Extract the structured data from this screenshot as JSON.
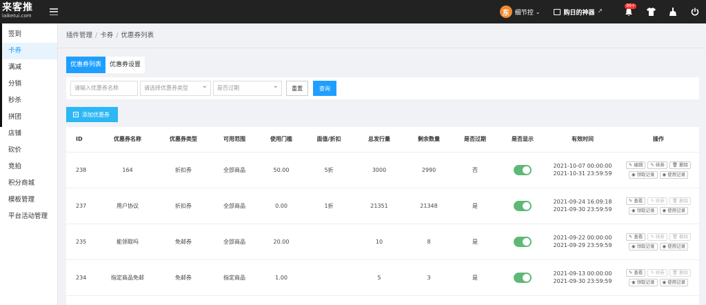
{
  "logo": {
    "main": "来客推",
    "sub": "laiketui.com"
  },
  "header": {
    "user_name": "细节控",
    "avatar_char": "东",
    "promo_label": "购日的神器",
    "notification_count": "99+"
  },
  "sidebar": {
    "items": [
      {
        "label": "签到",
        "active": false
      },
      {
        "label": "卡券",
        "active": true
      },
      {
        "label": "满减",
        "active": false
      },
      {
        "label": "分销",
        "active": false
      },
      {
        "label": "秒杀",
        "active": false
      },
      {
        "label": "拼团",
        "active": false
      },
      {
        "label": "店铺",
        "active": false
      },
      {
        "label": "砍价",
        "active": false
      },
      {
        "label": "竞拍",
        "active": false
      },
      {
        "label": "积分商城",
        "active": false
      },
      {
        "label": "模板管理",
        "active": false
      },
      {
        "label": "平台活动管理",
        "active": false
      }
    ]
  },
  "breadcrumb": [
    "插件管理",
    "卡券",
    "优惠券列表"
  ],
  "tabs": [
    "优惠券列表",
    "优惠券设置"
  ],
  "filters": {
    "name_placeholder": "请输入优惠券名称",
    "type_placeholder": "请选择优惠券类型",
    "expired_placeholder": "是否过期",
    "reset_label": "重置",
    "query_label": "查询"
  },
  "add_button_label": "添加优惠券",
  "table": {
    "headers": [
      "ID",
      "优惠券名称",
      "优惠券类型",
      "可用范围",
      "使用门槛",
      "面值/折扣",
      "总发行量",
      "剩余数量",
      "是否过期",
      "是否显示",
      "有效时间",
      "操作"
    ],
    "rows": [
      {
        "id": "238",
        "name": "164",
        "type": "折扣券",
        "scope": "全部商品",
        "threshold": "50.00",
        "value": "5折",
        "total": "3000",
        "remaining": "2990",
        "expired": "否",
        "show": true,
        "start": "2021-10-07 00:00:00",
        "end": "2021-10-31 23:59:59",
        "first_op": "编辑"
      },
      {
        "id": "237",
        "name": "用户协议",
        "type": "折扣券",
        "scope": "全部商品",
        "threshold": "0.00",
        "value": "1折",
        "total": "21351",
        "remaining": "21348",
        "expired": "是",
        "show": true,
        "start": "2021-09-24 16:09:18",
        "end": "2021-09-30 23:59:59",
        "first_op": "查看"
      },
      {
        "id": "235",
        "name": "能领取吗",
        "type": "免邮券",
        "scope": "全部商品",
        "threshold": "20.00",
        "value": "",
        "total": "10",
        "remaining": "8",
        "expired": "是",
        "show": true,
        "start": "2021-09-22 00:00:00",
        "end": "2021-09-29 23:59:59",
        "first_op": "查看"
      },
      {
        "id": "234",
        "name": "指定商品免邮",
        "type": "免邮券",
        "scope": "指定商品",
        "threshold": "1.00",
        "value": "",
        "total": "5",
        "remaining": "3",
        "expired": "是",
        "show": true,
        "start": "2021-09-13 00:00:00",
        "end": "2021-09-30 23:59:59",
        "first_op": "查看"
      }
    ],
    "ops": {
      "renew": "续券",
      "delete": "删除",
      "claim_record": "领取记录",
      "use_record": "使用记录"
    }
  }
}
